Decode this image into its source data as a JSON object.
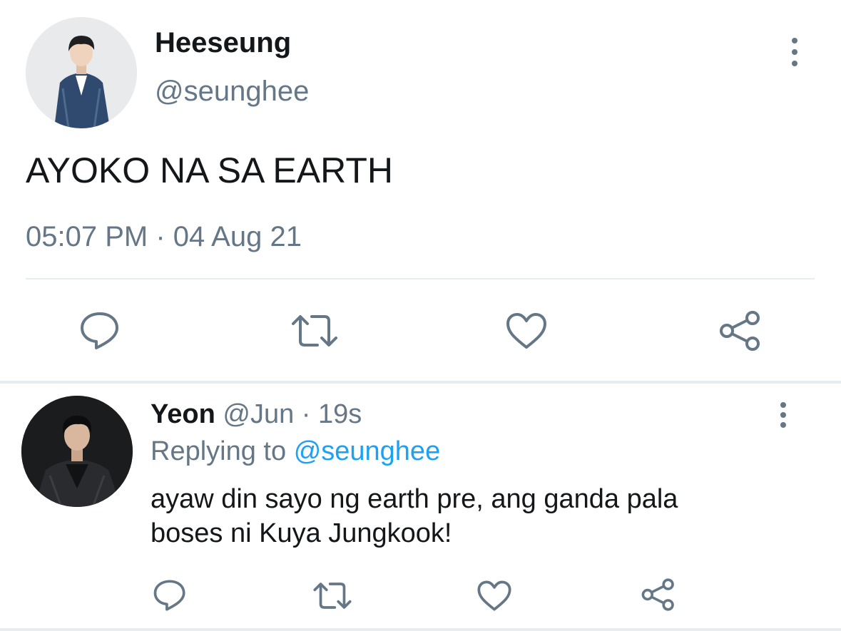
{
  "main_tweet": {
    "author_name": "Heeseung",
    "author_handle": "@seunghee",
    "text": "AYOKO NA SA EARTH",
    "timestamp": "05:07 PM · 04 Aug 21"
  },
  "reply": {
    "author_name": "Yeon",
    "author_meta": "@Jun · 19s",
    "replying_prefix": "Replying to",
    "replying_handle": "@seunghee",
    "text_line1": "ayaw din sayo ng earth pre, ang ganda pala",
    "text_line2": "boses ni Kuya Jungkook!"
  },
  "icons": {
    "reply": "comment-bubble-icon",
    "retweet": "retweet-icon",
    "like": "heart-icon",
    "share": "share-icon",
    "more": "more-vertical-icon"
  },
  "colors": {
    "text_primary": "#14171a",
    "text_secondary": "#657786",
    "link": "#1da1f2",
    "divider": "#e6ecf0"
  }
}
